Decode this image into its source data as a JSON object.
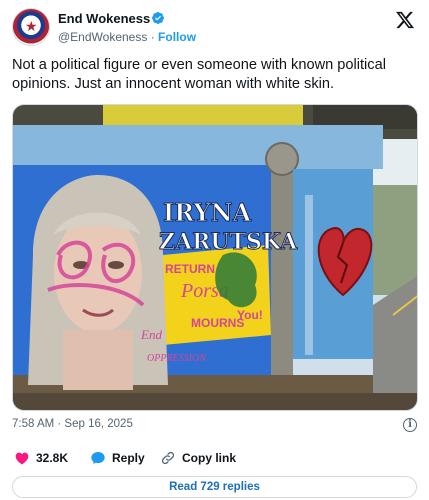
{
  "author": {
    "display_name": "End Wokeness",
    "handle": "@EndWokeness",
    "separator": "·",
    "follow_label": "Follow",
    "avatar_text": "★"
  },
  "tweet": {
    "text": "Not a political figure or even someone with known political opinions. Just an innocent woman with white skin.",
    "timestamp": "7:58 AM · Sep 16, 2025"
  },
  "media": {
    "mural_name_line1": "IRYNA",
    "mural_name_line2": "ZARUTSKA",
    "graffiti_words": [
      "RETURN",
      "Porsa",
      "MOURNS",
      "You!",
      "End",
      "OPPRESSION"
    ]
  },
  "actions": {
    "like_count": "32.8K",
    "reply_label": "Reply",
    "copy_link_label": "Copy link",
    "read_replies_label": "Read 729 replies",
    "info_glyph": "i"
  },
  "colors": {
    "accent": "#1d9bf0",
    "like": "#f91880",
    "text": "#0f1419",
    "muted": "#536471"
  }
}
